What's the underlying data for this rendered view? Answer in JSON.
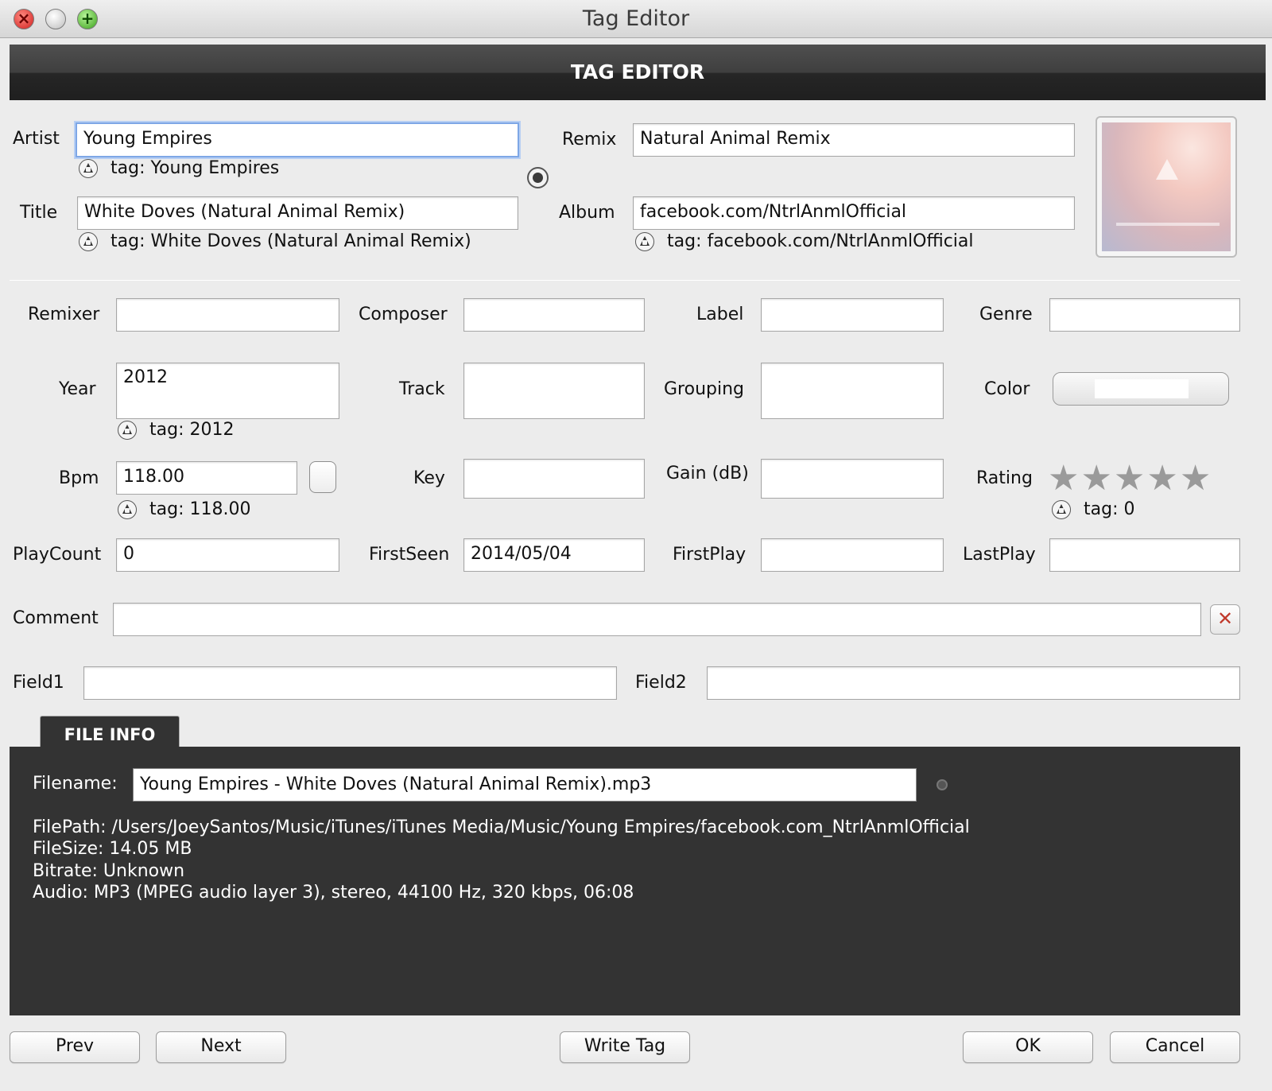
{
  "window": {
    "title": "Tag Editor"
  },
  "header": {
    "title": "TAG EDITOR"
  },
  "top": {
    "artist": {
      "label": "Artist",
      "value": "Young Empires",
      "tag": "tag: Young Empires"
    },
    "title": {
      "label": "Title",
      "value": "White Doves (Natural Animal Remix)",
      "tag": "tag: White Doves (Natural Animal Remix)"
    },
    "remix": {
      "label": "Remix",
      "value": "Natural Animal Remix"
    },
    "album": {
      "label": "Album",
      "value": "facebook.com/NtrlAnmlOfficial",
      "tag": "tag: facebook.com/NtrlAnmlOfficial"
    }
  },
  "fields": {
    "remixer": {
      "label": "Remixer",
      "value": ""
    },
    "composer": {
      "label": "Composer",
      "value": ""
    },
    "label": {
      "label": "Label",
      "value": ""
    },
    "genre": {
      "label": "Genre",
      "value": ""
    },
    "year": {
      "label": "Year",
      "value": "2012",
      "tag": "tag: 2012"
    },
    "track": {
      "label": "Track",
      "value": ""
    },
    "grouping": {
      "label": "Grouping",
      "value": ""
    },
    "color": {
      "label": "Color"
    },
    "bpm": {
      "label": "Bpm",
      "value": "118.00",
      "tag": "tag: 118.00"
    },
    "key": {
      "label": "Key",
      "value": ""
    },
    "gain": {
      "label": "Gain (dB)",
      "value": ""
    },
    "rating": {
      "label": "Rating",
      "stars": 0,
      "max": 5,
      "tag": "tag: 0"
    },
    "playcount": {
      "label": "PlayCount",
      "value": "0"
    },
    "firstseen": {
      "label": "FirstSeen",
      "value": "2014/05/04"
    },
    "firstplay": {
      "label": "FirstPlay",
      "value": ""
    },
    "lastplay": {
      "label": "LastPlay",
      "value": ""
    },
    "comment": {
      "label": "Comment",
      "value": ""
    },
    "field1": {
      "label": "Field1",
      "value": ""
    },
    "field2": {
      "label": "Field2",
      "value": ""
    }
  },
  "fileinfo": {
    "tab": "FILE INFO",
    "filename_label": "Filename:",
    "filename": "Young Empires - White Doves (Natural Animal Remix).mp3",
    "lines": [
      "FilePath: /Users/JoeySantos/Music/iTunes/iTunes Media/Music/Young Empires/facebook.com_NtrlAnmlOfficial",
      "FileSize: 14.05 MB",
      "Bitrate: Unknown",
      "Audio: MP3 (MPEG audio layer 3), stereo, 44100 Hz, 320 kbps, 06:08"
    ]
  },
  "buttons": {
    "prev": "Prev",
    "next": "Next",
    "write": "Write Tag",
    "ok": "OK",
    "cancel": "Cancel"
  },
  "icons": {
    "tag_restore": "restore-tag-icon",
    "clear": "clear-icon",
    "star": "star-icon"
  },
  "colors": {
    "header_bg": "#2b2b2b",
    "panel_bg": "#333333",
    "focus": "#7ea7e6"
  }
}
